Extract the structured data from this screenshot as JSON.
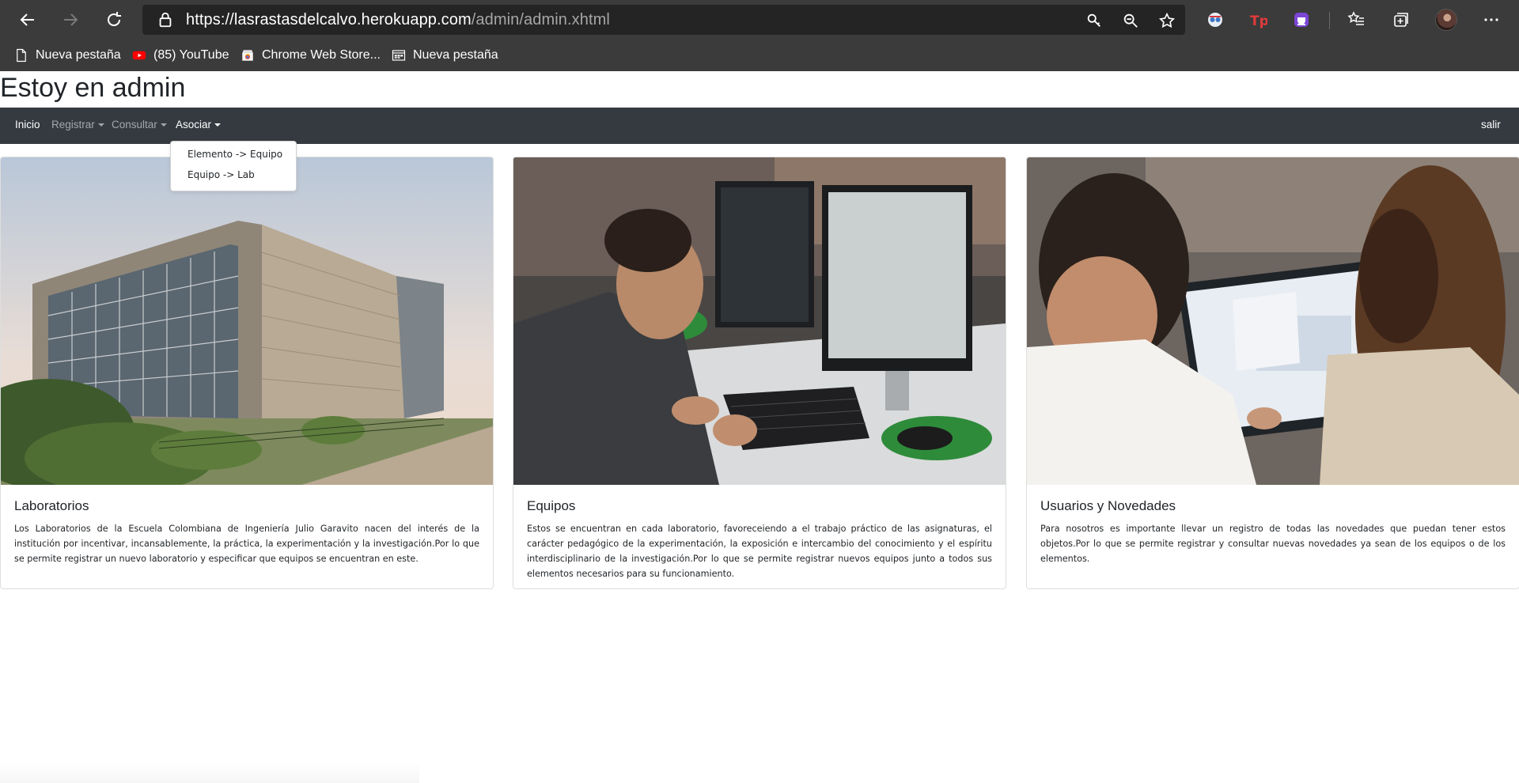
{
  "browser": {
    "url_host": "https://lasrastasdelcalvo.herokuapp.com",
    "url_path": "/admin/admin.xhtml",
    "bookmarks": [
      {
        "label": "Nueva pestaña",
        "icon": "page-icon"
      },
      {
        "label": "(85) YouTube",
        "icon": "youtube-icon"
      },
      {
        "label": "Chrome Web Store...",
        "icon": "chrome-web-store-icon"
      },
      {
        "label": "Nueva pestaña",
        "icon": "grid-page-icon"
      }
    ],
    "colors": {
      "toolbar": "#3b3b3b",
      "address_bar": "#242424",
      "url_path": "#a6a6a6"
    }
  },
  "page": {
    "title": "Estoy en admin"
  },
  "navbar": {
    "items": [
      {
        "label": "Inicio",
        "active": true,
        "dropdown": false
      },
      {
        "label": "Registrar",
        "active": false,
        "dropdown": true
      },
      {
        "label": "Consultar",
        "active": false,
        "dropdown": true
      },
      {
        "label": "Asociar",
        "active": true,
        "dropdown": true
      }
    ],
    "right_link": "salir",
    "open_dropdown": {
      "parent": "Asociar",
      "items": [
        "Elemento -> Equipo",
        "Equipo -> Lab"
      ]
    },
    "color": "#343a40"
  },
  "cards": [
    {
      "title": "Laboratorios",
      "image": "university building photo",
      "text": "Los Laboratorios de la Escuela Colombiana de Ingeniería Julio Garavito nacen del interés de la institución por incentivar, incansablemente, la práctica, la experimentación y la investigación.Por lo que se permite registrar un nuevo laboratorio y especificar que equipos se encuentran en este."
    },
    {
      "title": "Equipos",
      "image": "student at computer photo",
      "text": "Estos se encuentran en cada laboratorio, favoreceiendo a el trabajo práctico de las asignaturas, el carácter pedagógico de la experimentación, la exposición e intercambio del conocimiento y el espíritu interdisciplinario de la investigación.Por lo que se permite registrar nuevos equipos junto a todos sus elementos necesarios para su funcionamiento."
    },
    {
      "title": "Usuarios y Novedades",
      "image": "two students at laptop photo",
      "text": "Para nosotros es importante llevar un registro de todas las novedades que puedan tener estos objetos.Por lo que se permite registrar y consultar nuevas novedades ya sean de los equipos o de los elementos."
    }
  ]
}
